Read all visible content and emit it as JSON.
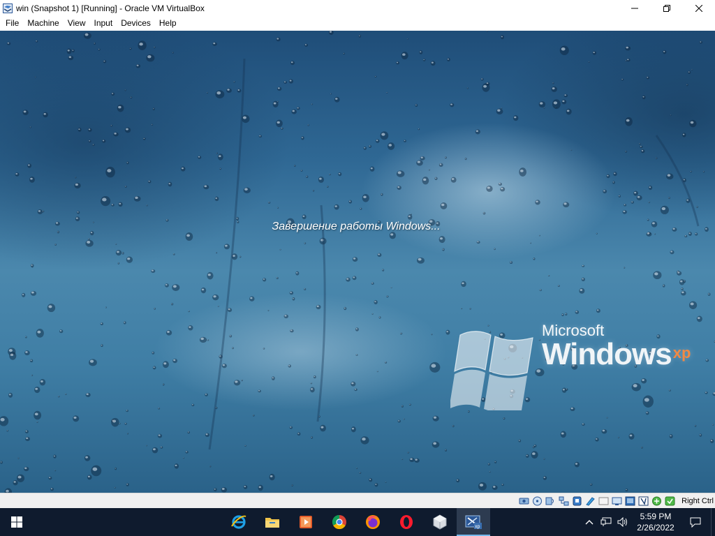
{
  "window": {
    "title": "win (Snapshot 1) [Running] - Oracle VM VirtualBox",
    "controls": [
      "minimize",
      "restore",
      "close"
    ]
  },
  "menu": [
    "File",
    "Machine",
    "View",
    "Input",
    "Devices",
    "Help"
  ],
  "guest": {
    "shutdown_text": "Завершение работы Windows...",
    "logo_company": "Microsoft",
    "logo_product": "Windows",
    "logo_suffix": "xp"
  },
  "statusbar": {
    "icons": [
      "hard-disk-icon",
      "optical-drive-icon",
      "audio-icon",
      "network-icon",
      "usb-icon",
      "shared-folders-icon",
      "display-icon",
      "video-capture-icon",
      "virtualization-icon",
      "mouse-integration-icon",
      "keyboard-capture-icon"
    ],
    "host_key": "Right Ctrl"
  },
  "taskbar": {
    "apps": [
      "Internet Explorer",
      "File Explorer",
      "Media Player",
      "Google Chrome",
      "Firefox",
      "Opera",
      "VirtualBox",
      "win (XP VM)"
    ],
    "active_app_index": 7,
    "time": "5:59 PM",
    "date": "2/26/2022"
  },
  "colors": {
    "taskbar_bg": "#0f1b2e",
    "active_indicator": "#76b9ed",
    "xp_suffix": "#ff8a3c"
  }
}
